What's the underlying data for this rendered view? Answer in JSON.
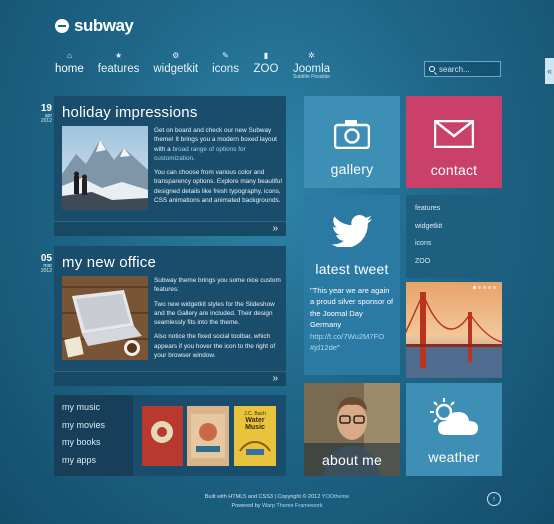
{
  "logo": {
    "text": "subway"
  },
  "nav": {
    "items": [
      {
        "label": "home",
        "icon": "home-icon",
        "glyph": "⌂"
      },
      {
        "label": "features",
        "icon": "star-icon",
        "glyph": "★"
      },
      {
        "label": "widgetkit",
        "icon": "cogs-icon",
        "glyph": "⚙"
      },
      {
        "label": "icons",
        "icon": "wrench-icon",
        "glyph": "✎"
      },
      {
        "label": "ZOO",
        "icon": "document-icon",
        "glyph": "▮"
      },
      {
        "label": "Joomla",
        "icon": "joomla-icon",
        "glyph": "✲",
        "sub": "Subtitle Possible"
      }
    ]
  },
  "search": {
    "placeholder": "search..."
  },
  "social_tab": {
    "glyph": "«"
  },
  "posts": [
    {
      "date": {
        "day": "19",
        "month": "apr",
        "year": "2012"
      },
      "title": "holiday impressions",
      "paragraphs": [
        {
          "text_before": "Get on board and check our new Subway theme! It brings you a modern boxed layout with a ",
          "link": "broad range of options for customization",
          "text_after": "."
        },
        {
          "text_before": "You can choose from various color and transparency options. Explore many beautiful designed details like fresh typography, icons, CSS animations and animated backgrounds.",
          "link": "",
          "text_after": ""
        }
      ],
      "more": "»"
    },
    {
      "date": {
        "day": "05",
        "month": "mar",
        "year": "2012"
      },
      "title": "my new office",
      "paragraphs": [
        {
          "text_before": "Subway theme brings you some nice custom features:",
          "link": "",
          "text_after": ""
        },
        {
          "text_before": "Two new widgetkit styles for the Slideshow and the Gallery are included. Their design seamlessly fits into the theme.",
          "link": "",
          "text_after": ""
        },
        {
          "text_before": "Also notice the fixed social toolbar, which appears if you hover the icon to the right of your browser window.",
          "link": "",
          "text_after": ""
        }
      ],
      "more": "»"
    }
  ],
  "media": {
    "links": [
      "my music",
      "my movies",
      "my books",
      "my apps"
    ],
    "covers": [
      {
        "lines": [
          "",
          "",
          ""
        ],
        "color": "#b8392e"
      },
      {
        "lines": [
          "",
          "",
          ""
        ],
        "color": "#d9b48a"
      },
      {
        "lines": [
          "J.C. Bach",
          "Water",
          "Music"
        ],
        "color": "#e8c43c"
      }
    ]
  },
  "tiles": {
    "gallery": {
      "label": "gallery",
      "color": "#3d8fb5",
      "icon": "camera-icon"
    },
    "contact": {
      "label": "contact",
      "color": "#c9406b",
      "icon": "mail-icon"
    },
    "tweet": {
      "label": "latest tweet",
      "color": "#2b7aa3",
      "icon": "twitter-bird-icon",
      "text": "\"This year we are again a proud silver sponsor of the Joomal Day Germany ",
      "link": "http://t.co/7Wu2M7FO",
      "hash": "#jd12de",
      "end": "\""
    },
    "menu": {
      "items": [
        "features",
        "widgetkit",
        "icons",
        "ZOO"
      ],
      "color": "#1e5f80"
    },
    "about": {
      "label": "about me"
    },
    "weather": {
      "label": "weather",
      "color": "#3d8fb5",
      "icon": "sun-cloud-icon"
    }
  },
  "footer": {
    "line1_before": "Built with HTML5 and CSS3 | Copyright © 2012 ",
    "line1_link": "YOOtheme",
    "line2_before": "Powered by ",
    "line2_link": "Warp Theme Framework",
    "to_top": "↑"
  }
}
